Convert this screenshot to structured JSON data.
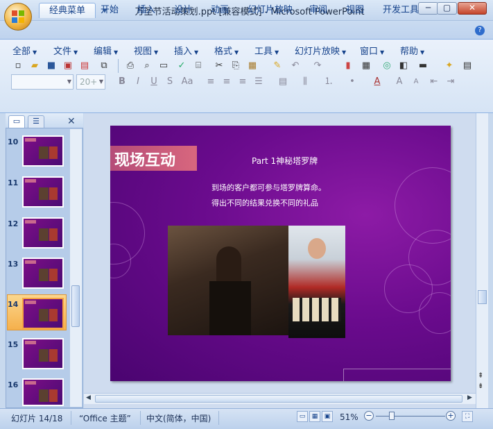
{
  "window": {
    "title": "万圣节活动策划.ppt [兼容模式] - Microsoft PowerPoint",
    "minimize_label": "─",
    "maximize_label": "▢",
    "close_label": "✕"
  },
  "quick_access": [
    "💾",
    "↶",
    "↻",
    "▾"
  ],
  "ribbon_tabs": [
    "经典菜单",
    "开始",
    "插入",
    "设计",
    "动画",
    "幻灯片放映",
    "审阅",
    "视图",
    "开发工具"
  ],
  "active_tab": "经典菜单",
  "help_label": "?",
  "menu": [
    "全部",
    "文件",
    "编辑",
    "视图",
    "插入",
    "格式",
    "工具",
    "幻灯片放映",
    "窗口",
    "帮助"
  ],
  "font_combo": {
    "value": "",
    "size": "20+"
  },
  "pane": {
    "close_label": "✕",
    "slides": [
      {
        "number": "10",
        "selected": false
      },
      {
        "number": "11",
        "selected": false
      },
      {
        "number": "12",
        "selected": false
      },
      {
        "number": "13",
        "selected": false
      },
      {
        "number": "14",
        "selected": true
      },
      {
        "number": "15",
        "selected": false
      },
      {
        "number": "16",
        "selected": false
      }
    ]
  },
  "slide": {
    "heading": "现场互动",
    "subtitle": "Part 1神秘塔罗牌",
    "line1": "到场的客户都可参与塔罗牌算命。",
    "line2": "得出不同的结果兑换不同的礼品"
  },
  "status": {
    "slide_info": "幻灯片 14/18",
    "theme": "“Office 主题”",
    "language": "中文(简体，中国)",
    "zoom": "51%",
    "zoom_level_percent": 51
  },
  "colors": {
    "slide_purple": "#6a0b8d",
    "heading_band": "#d8677e",
    "selected_thumb": "#f5b04c"
  }
}
